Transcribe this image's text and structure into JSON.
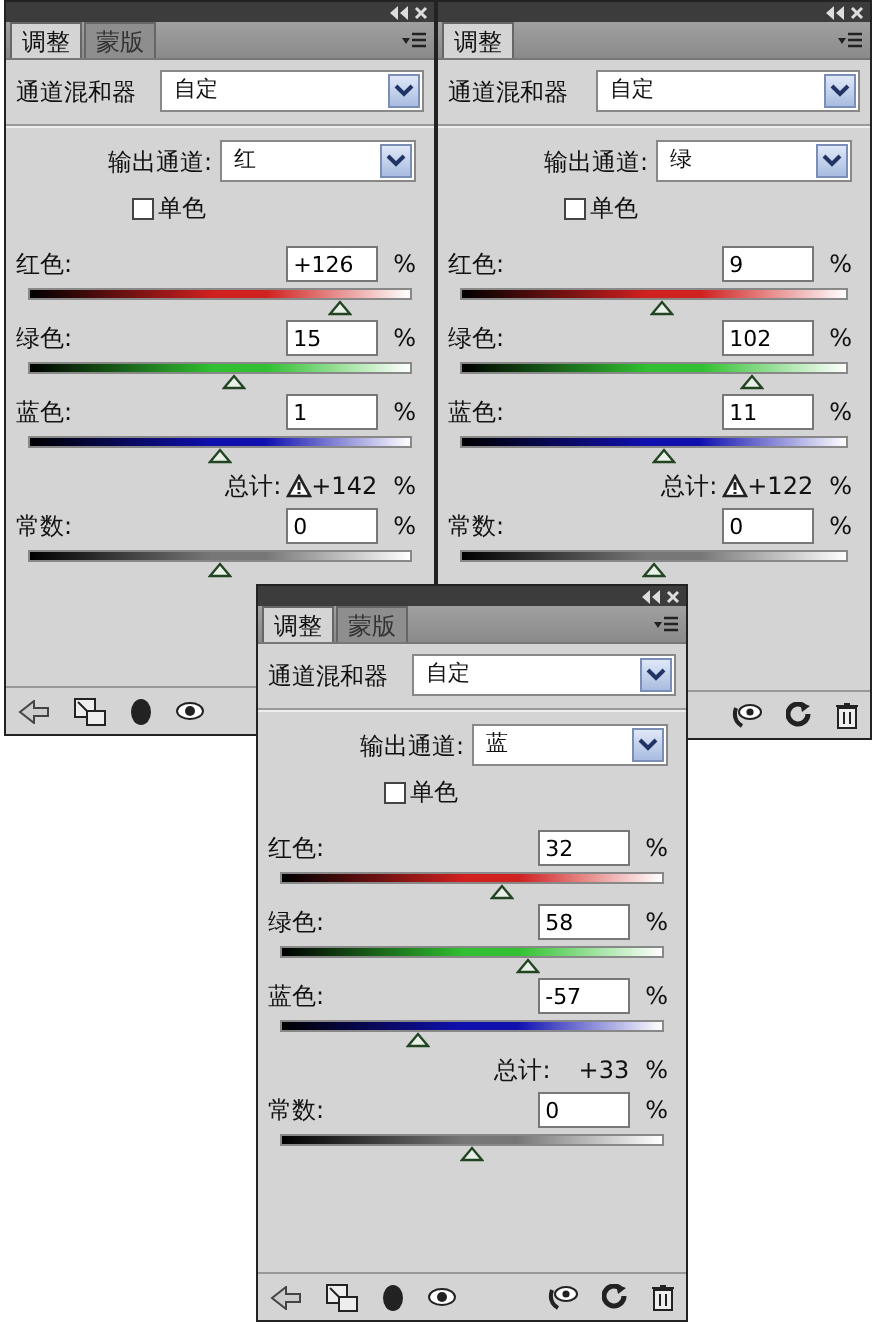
{
  "panels": [
    {
      "tabs": [
        {
          "label": "调整",
          "selected": true
        },
        {
          "label": "蒙版",
          "selected": false
        }
      ],
      "preset_label": "通道混和器",
      "preset": "自定",
      "output_label": "输出通道:",
      "output_channel": "红",
      "monochrome": {
        "label": "单色",
        "checked": false
      },
      "sources": [
        {
          "label": "红色:",
          "value": "+126",
          "unit": "%",
          "level": 0.815,
          "color": "#d02020"
        },
        {
          "label": "绿色:",
          "value": "15",
          "unit": "%",
          "level": 0.5375,
          "color": "#30c030"
        },
        {
          "label": "蓝色:",
          "value": "1",
          "unit": "%",
          "level": 0.5025,
          "color": "#1010b0"
        }
      ],
      "total": {
        "label": "总计:",
        "value": "+142",
        "unit": "%",
        "warning": true
      },
      "constant": {
        "label": "常数:",
        "value": "0",
        "unit": "%",
        "level": 0.5
      }
    },
    {
      "tabs": [
        {
          "label": "调整",
          "selected": true
        }
      ],
      "preset_label": "通道混和器",
      "preset": "自定",
      "output_label": "输出通道:",
      "output_channel": "绿",
      "monochrome": {
        "label": "单色",
        "checked": false
      },
      "sources": [
        {
          "label": "红色:",
          "value": "9",
          "unit": "%",
          "level": 0.5225,
          "color": "#d02020"
        },
        {
          "label": "绿色:",
          "value": "102",
          "unit": "%",
          "level": 0.755,
          "color": "#30c030"
        },
        {
          "label": "蓝色:",
          "value": "11",
          "unit": "%",
          "level": 0.5275,
          "color": "#1010b0"
        }
      ],
      "total": {
        "label": "总计:",
        "value": "+122",
        "unit": "%",
        "warning": true
      },
      "constant": {
        "label": "常数:",
        "value": "0",
        "unit": "%",
        "level": 0.5
      }
    },
    {
      "tabs": [
        {
          "label": "调整",
          "selected": true
        },
        {
          "label": "蒙版",
          "selected": false
        }
      ],
      "preset_label": "通道混和器",
      "preset": "自定",
      "output_label": "输出通道:",
      "output_channel": "蓝",
      "monochrome": {
        "label": "单色",
        "checked": false
      },
      "sources": [
        {
          "label": "红色:",
          "value": "32",
          "unit": "%",
          "level": 0.58,
          "color": "#d02020"
        },
        {
          "label": "绿色:",
          "value": "58",
          "unit": "%",
          "level": 0.645,
          "color": "#30c030"
        },
        {
          "label": "蓝色:",
          "value": "-57",
          "unit": "%",
          "level": 0.3575,
          "color": "#1010b0"
        }
      ],
      "total": {
        "label": "总计:",
        "value": "+33",
        "unit": "%",
        "warning": false
      },
      "constant": {
        "label": "常数:",
        "value": "0",
        "unit": "%",
        "level": 0.5
      }
    }
  ]
}
